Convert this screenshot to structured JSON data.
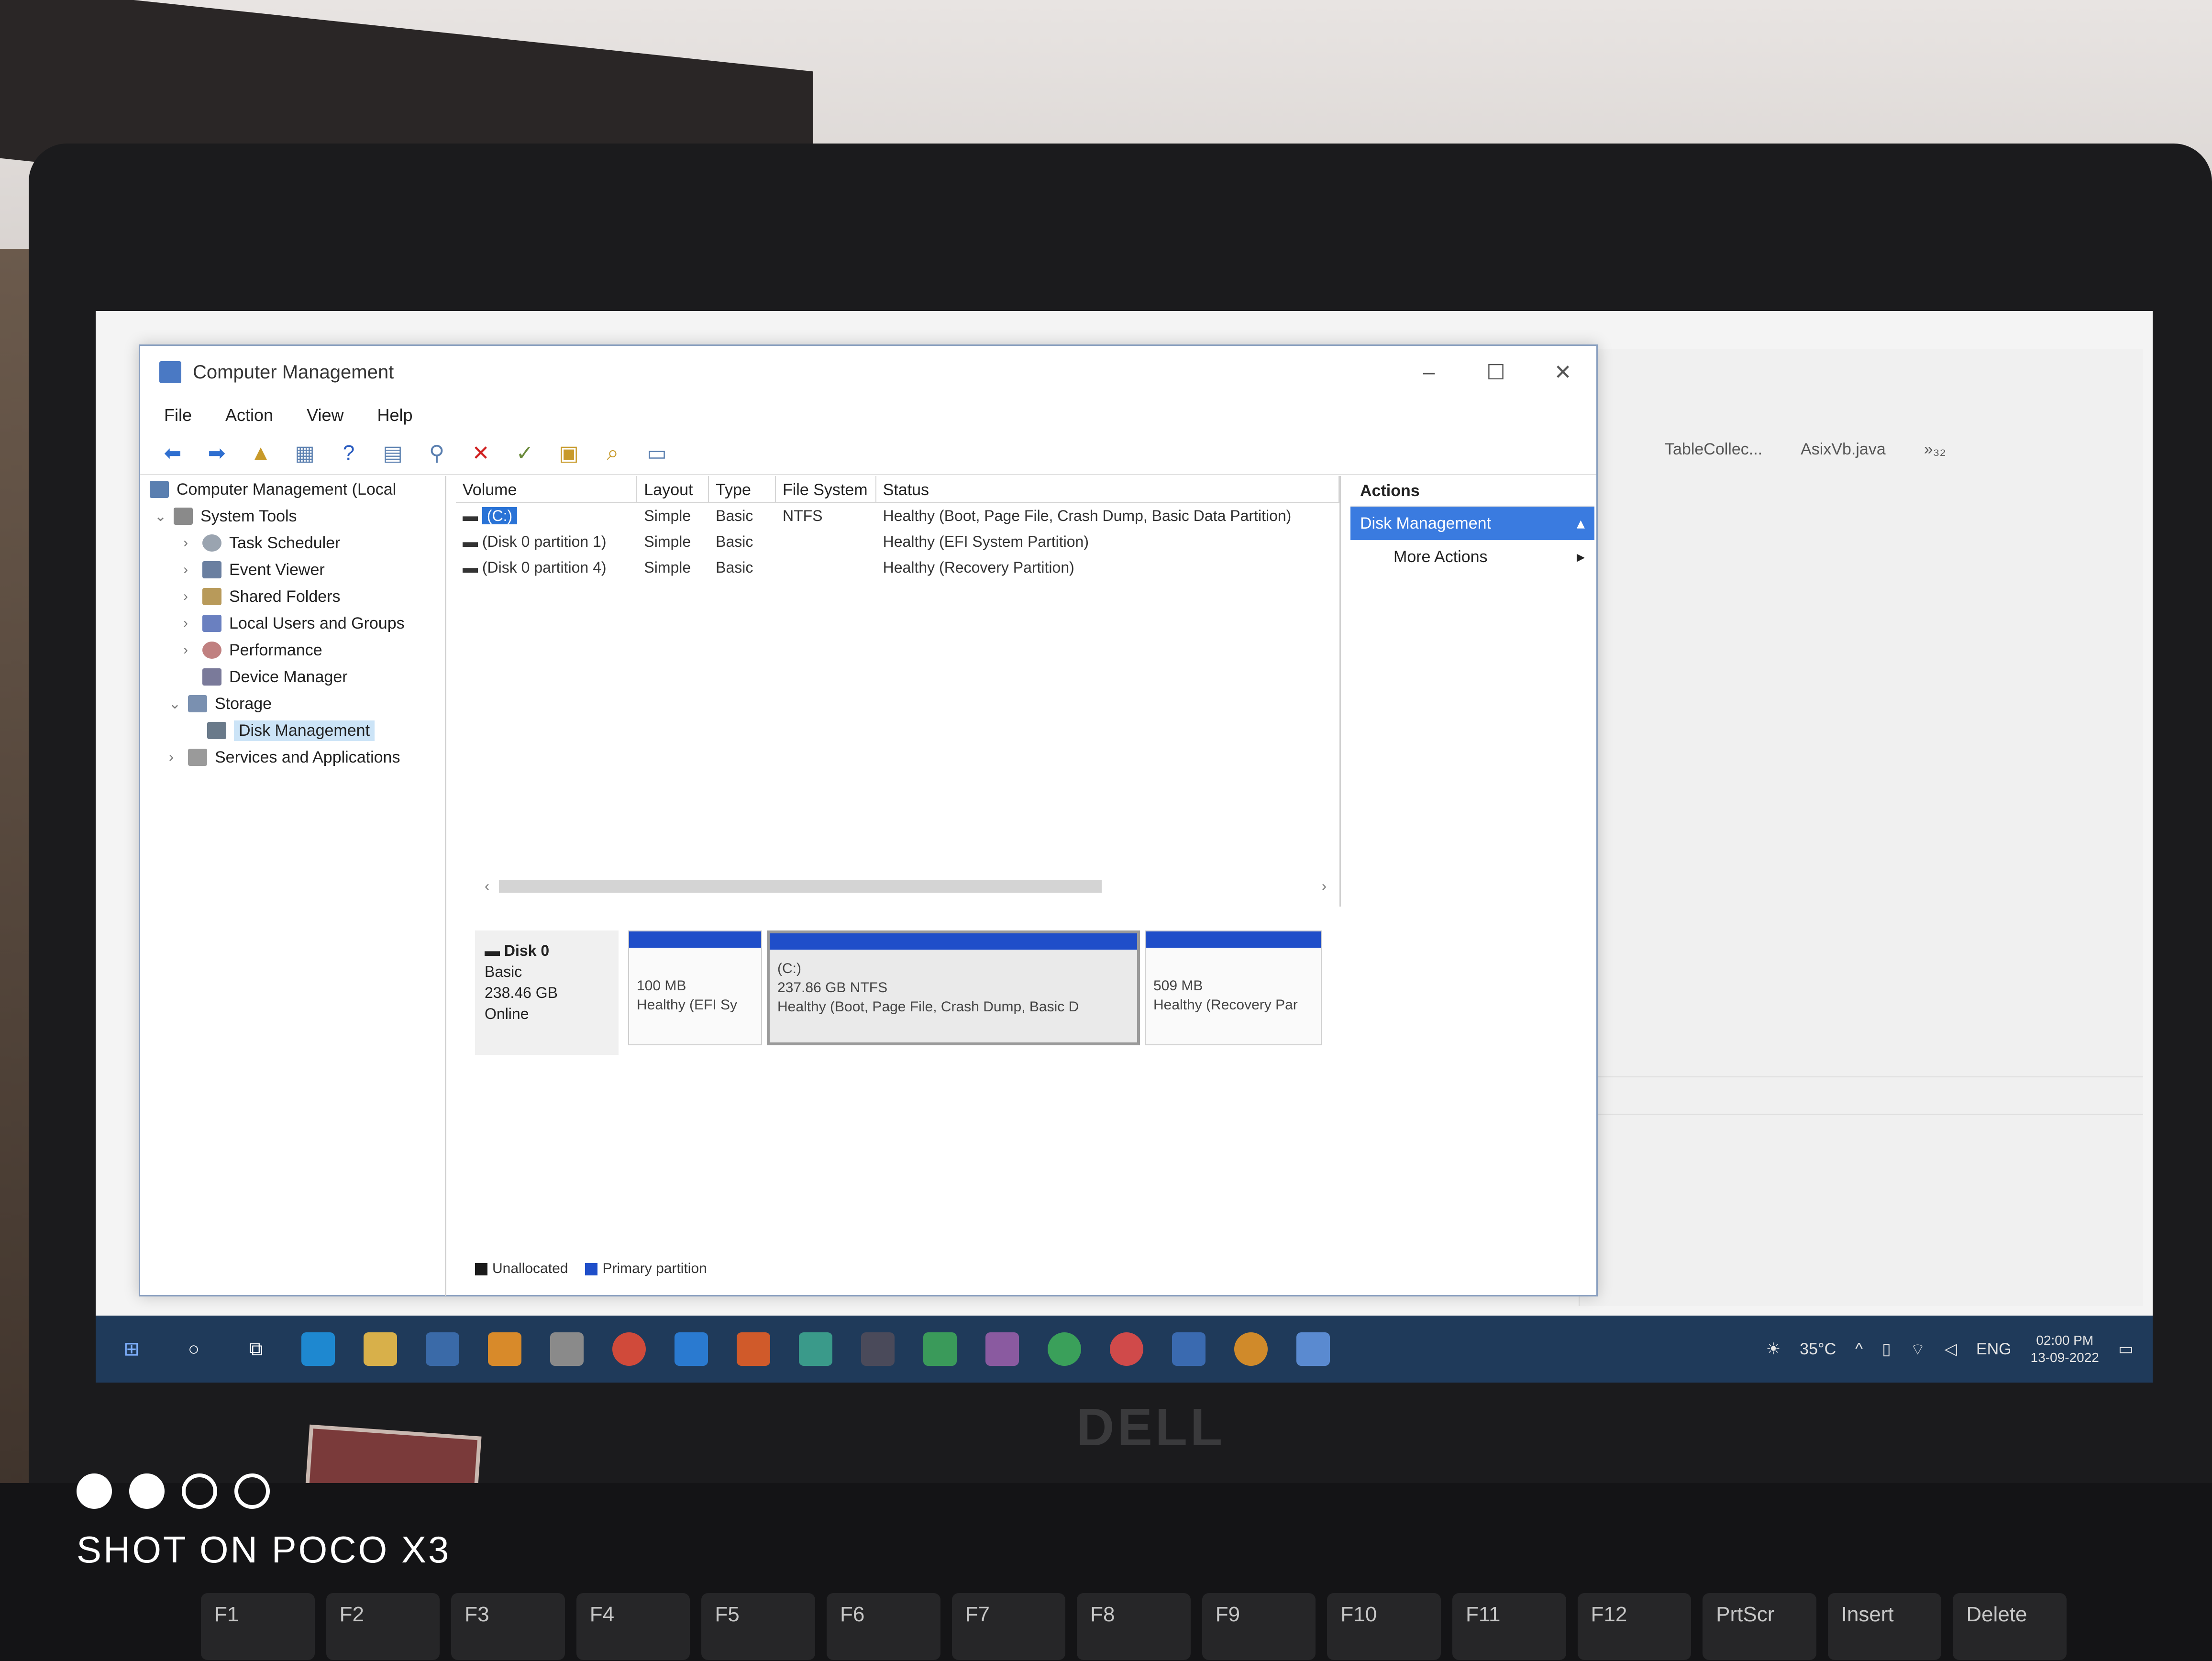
{
  "window": {
    "title": "Computer Management",
    "controls": {
      "minimize": "–",
      "maximize": "☐",
      "close": "✕"
    }
  },
  "menu": [
    "File",
    "Action",
    "View",
    "Help"
  ],
  "tree": {
    "root": "Computer Management (Local",
    "system_tools": "System Tools",
    "task_scheduler": "Task Scheduler",
    "event_viewer": "Event Viewer",
    "shared_folders": "Shared Folders",
    "local_users": "Local Users and Groups",
    "performance": "Performance",
    "device_manager": "Device Manager",
    "storage": "Storage",
    "disk_management": "Disk Management",
    "services": "Services and Applications"
  },
  "volumes": {
    "headers": [
      "Volume",
      "Layout",
      "Type",
      "File System",
      "Status"
    ],
    "rows": [
      {
        "volume": "(C:)",
        "layout": "Simple",
        "type": "Basic",
        "fs": "NTFS",
        "status": "Healthy (Boot, Page File, Crash Dump, Basic Data Partition)"
      },
      {
        "volume": "(Disk 0 partition 1)",
        "layout": "Simple",
        "type": "Basic",
        "fs": "",
        "status": "Healthy (EFI System Partition)"
      },
      {
        "volume": "(Disk 0 partition 4)",
        "layout": "Simple",
        "type": "Basic",
        "fs": "",
        "status": "Healthy (Recovery Partition)"
      }
    ]
  },
  "disk": {
    "name": "Disk 0",
    "kind": "Basic",
    "size": "238.46 GB",
    "state": "Online",
    "partitions": [
      {
        "line1": "",
        "line2": "100 MB",
        "line3": "Healthy (EFI Sy"
      },
      {
        "line1": "(C:)",
        "line2": "237.86 GB NTFS",
        "line3": "Healthy (Boot, Page File, Crash Dump, Basic D"
      },
      {
        "line1": "",
        "line2": "509 MB",
        "line3": "Healthy (Recovery Par"
      }
    ]
  },
  "legend": {
    "unallocated": "Unallocated",
    "primary": "Primary partition"
  },
  "actions": {
    "header": "Actions",
    "selected": "Disk Management",
    "more": "More Actions"
  },
  "eclipse": {
    "tab1": "TableCollec...",
    "tab2": "AsixVb.java",
    "tab_overflow": "»₃₂"
  },
  "taskbar": {
    "temp": "35°C",
    "lang": "ENG",
    "time": "02:00 PM",
    "date": "13-09-2022"
  },
  "photo": {
    "watermark": "SHOT ON POCO X3",
    "brand": "DELL",
    "keys": [
      "F1",
      "F2",
      "F3",
      "F4",
      "F5",
      "F6",
      "F7",
      "F8",
      "F9",
      "F10",
      "F11",
      "F12",
      "PrtScr",
      "Insert",
      "Delete"
    ]
  },
  "colors": {
    "partition_band": "#1f4ec9",
    "selection": "#2a73d6",
    "actions_highlight": "#3a7be0",
    "unallocated": "#1a1a1a"
  }
}
